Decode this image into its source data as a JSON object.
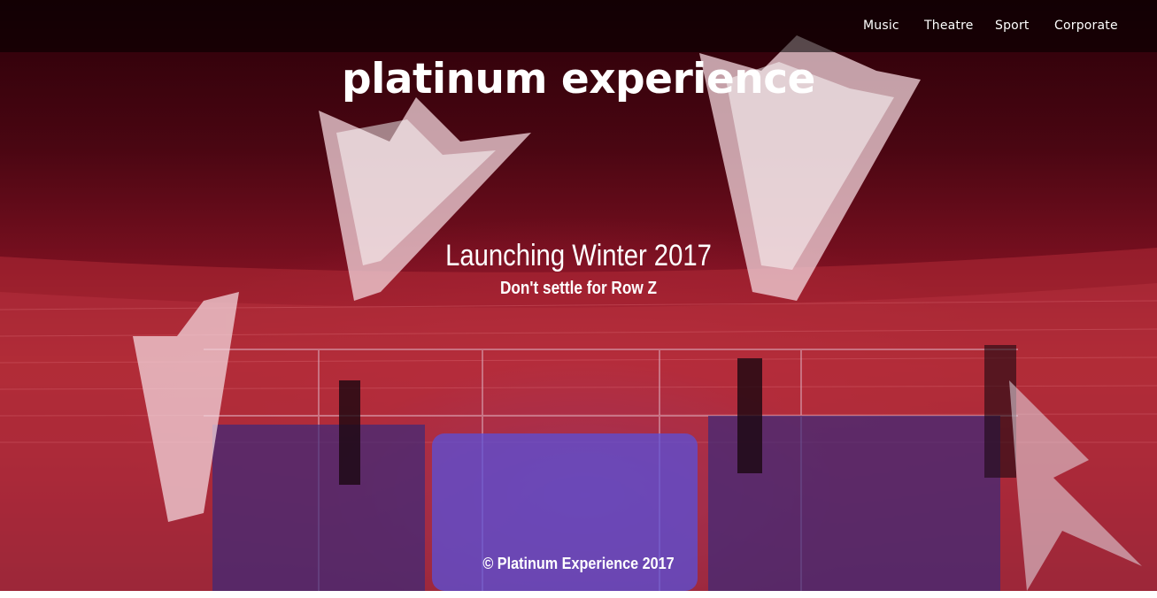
{
  "nav": {
    "items": [
      {
        "label": "Music"
      },
      {
        "label": "Theatre"
      },
      {
        "label": "Sport"
      },
      {
        "label": "Corporate"
      }
    ]
  },
  "brand": {
    "title": "platinum experience"
  },
  "hero": {
    "headline": "Launching Winter 2017",
    "tagline": "Don't settle for Row Z"
  },
  "footer": {
    "copyright": "© Platinum Experience 2017"
  },
  "colors": {
    "overlay_red": "#a3202c",
    "stage_screen_blue": "#4a3fc8",
    "text": "#ffffff",
    "nav_background": "#000000"
  },
  "background_image": {
    "description_icon": "stadium-concert-photo"
  }
}
